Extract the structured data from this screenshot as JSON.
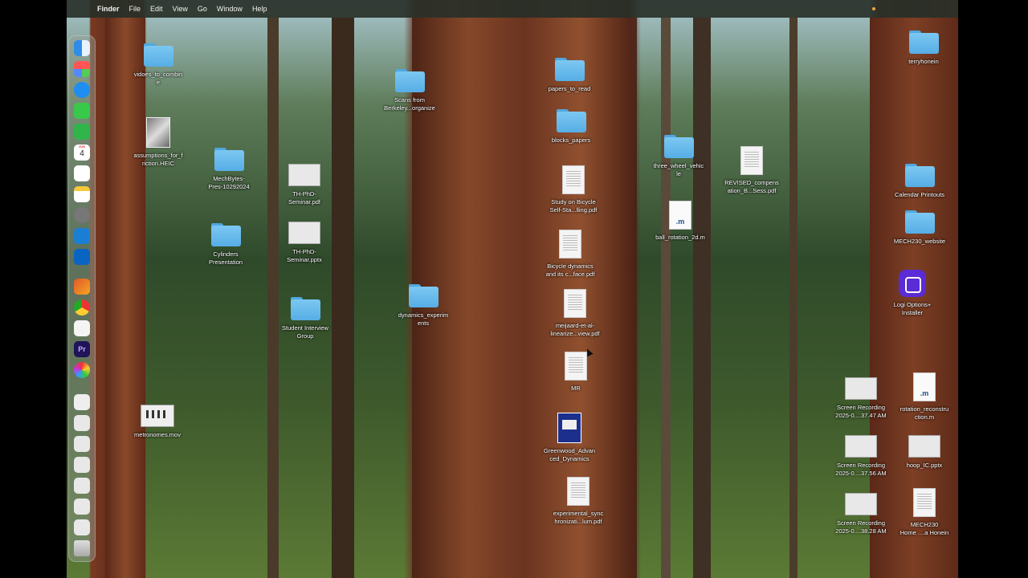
{
  "menubar": {
    "apple_icon": "",
    "app_name": "Finder",
    "menus": [
      "File",
      "Edit",
      "View",
      "Go",
      "Window",
      "Help"
    ]
  },
  "dock": {
    "apps": [
      "finder-icon",
      "launchpad-icon",
      "safari-icon",
      "messages-icon",
      "facetime-icon",
      "calendar-icon",
      "reminders-icon",
      "notes-icon",
      "system-settings-icon",
      "vscode-icon",
      "outlook-icon",
      "matlab-icon",
      "chrome-icon",
      "textedit-icon",
      "premiere-icon",
      "pinwheel-icon",
      "document-icon",
      "screenshot-icon",
      "trash-icon"
    ],
    "calendar_day": "4",
    "calendar_month": "JUN"
  },
  "desktop": {
    "items": [
      {
        "label": "vidoes_to_combin\ne",
        "kind": "folder"
      },
      {
        "label": "assumptions_for_f\nriction.HEIC",
        "kind": "heic"
      },
      {
        "label": "MechBytes-\nPres-10292024",
        "kind": "folder"
      },
      {
        "label": "TH-PhD-\nSeminar.pdf",
        "kind": "thumb"
      },
      {
        "label": "Cylinders\nPresentation",
        "kind": "folder"
      },
      {
        "label": "TH-PhD-\nSeminar.pptx",
        "kind": "thumb"
      },
      {
        "label": "Student Interview\nGroup",
        "kind": "folder"
      },
      {
        "label": "metronomes.mov",
        "kind": "movie"
      },
      {
        "label": "Scans from\nBerkeley...organize",
        "kind": "folder"
      },
      {
        "label": "dynamics_experim\nents",
        "kind": "folder"
      },
      {
        "label": "papers_to_read",
        "kind": "folder"
      },
      {
        "label": "blocks_papers",
        "kind": "folder"
      },
      {
        "label": "Study on Bicycle\nSelf-Sta...lling.pdf",
        "kind": "doc"
      },
      {
        "label": "Bicycle dynamics\nand its c...face.pdf",
        "kind": "doc"
      },
      {
        "label": "meijaard-et-al-\nlinearize...view.pdf",
        "kind": "doc"
      },
      {
        "label": "MR",
        "kind": "doc"
      },
      {
        "label": "Greenwood_Advan\nced_Dynamics",
        "kind": "book"
      },
      {
        "label": "experimental_sync\nhronizati...lum.pdf",
        "kind": "doc"
      },
      {
        "label": "three_wheel_vehic\nle",
        "kind": "folder"
      },
      {
        "label": "ball_rotation_2d.m",
        "kind": "mfile"
      },
      {
        "label": "REVISED_compens\nation_B...Sess.pdf",
        "kind": "doc"
      },
      {
        "label": "terryhonein",
        "kind": "folder"
      },
      {
        "label": "Calendar Printouts",
        "kind": "folder"
      },
      {
        "label": "MECH230_website",
        "kind": "folder"
      },
      {
        "label": "Logi Options+\nInstaller",
        "kind": "logi"
      },
      {
        "label": "Screen Recording\n2025-0....37.47 AM",
        "kind": "thumb"
      },
      {
        "label": "rotation_reconstru\nction.m",
        "kind": "mfile"
      },
      {
        "label": "Screen Recording\n2025-0....37.56 AM",
        "kind": "thumb"
      },
      {
        "label": "hoop_IC.pptx",
        "kind": "thumb"
      },
      {
        "label": "Screen Recording\n2025-0....38.28 AM",
        "kind": "thumb"
      },
      {
        "label": "MECH230\nHome ....a Honein",
        "kind": "doc"
      }
    ],
    "m_file_glyph": ".m"
  }
}
